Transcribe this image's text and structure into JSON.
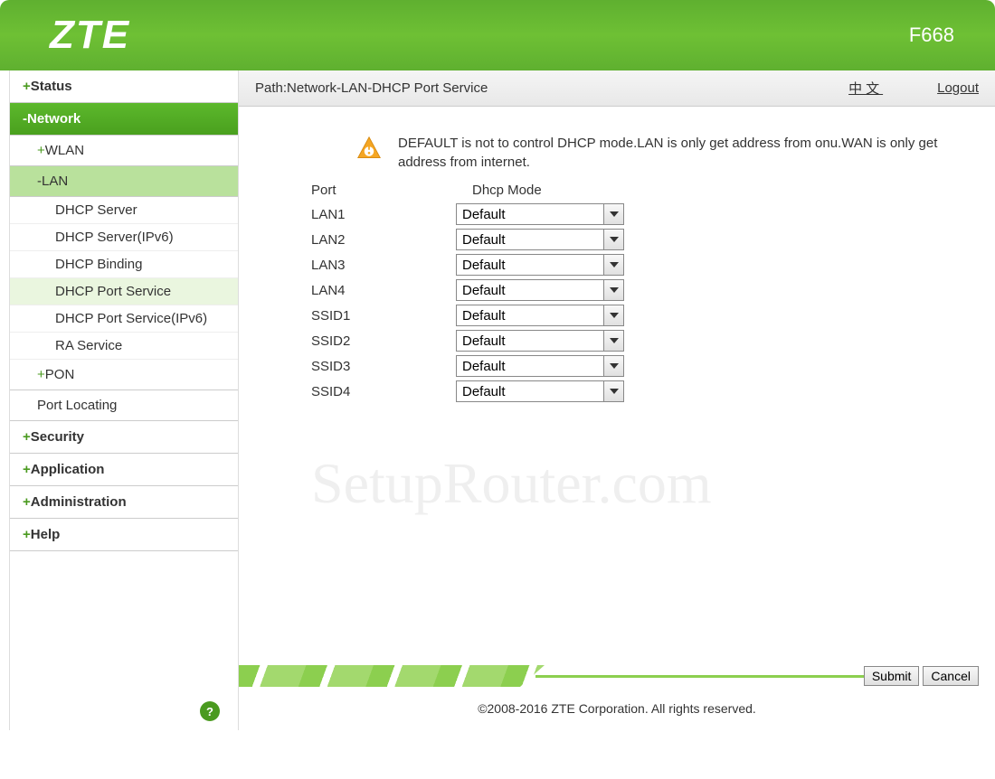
{
  "header": {
    "logo": "ZTE",
    "model": "F668"
  },
  "breadcrumb": {
    "path": "Path:Network-LAN-DHCP Port Service",
    "lang": "中文",
    "logout": "Logout"
  },
  "sidebar": {
    "status": "Status",
    "network": "Network",
    "wlan": "WLAN",
    "lan": "LAN",
    "dhcp_server": "DHCP Server",
    "dhcp_server_ipv6": "DHCP Server(IPv6)",
    "dhcp_binding": "DHCP Binding",
    "dhcp_port_service": "DHCP Port Service",
    "dhcp_port_service_ipv6": "DHCP Port Service(IPv6)",
    "ra_service": "RA Service",
    "pon": "PON",
    "port_locating": "Port Locating",
    "security": "Security",
    "application": "Application",
    "administration": "Administration",
    "help": "Help"
  },
  "info_text": "DEFAULT is not to control DHCP mode.LAN is only get address from onu.WAN is only get address from internet.",
  "table": {
    "port_header": "Port",
    "mode_header": "Dhcp Mode",
    "rows": [
      {
        "port": "LAN1",
        "mode": "Default"
      },
      {
        "port": "LAN2",
        "mode": "Default"
      },
      {
        "port": "LAN3",
        "mode": "Default"
      },
      {
        "port": "LAN4",
        "mode": "Default"
      },
      {
        "port": "SSID1",
        "mode": "Default"
      },
      {
        "port": "SSID2",
        "mode": "Default"
      },
      {
        "port": "SSID3",
        "mode": "Default"
      },
      {
        "port": "SSID4",
        "mode": "Default"
      }
    ]
  },
  "buttons": {
    "submit": "Submit",
    "cancel": "Cancel"
  },
  "watermark": "SetupRouter.com",
  "copyright": "©2008-2016 ZTE Corporation. All rights reserved."
}
